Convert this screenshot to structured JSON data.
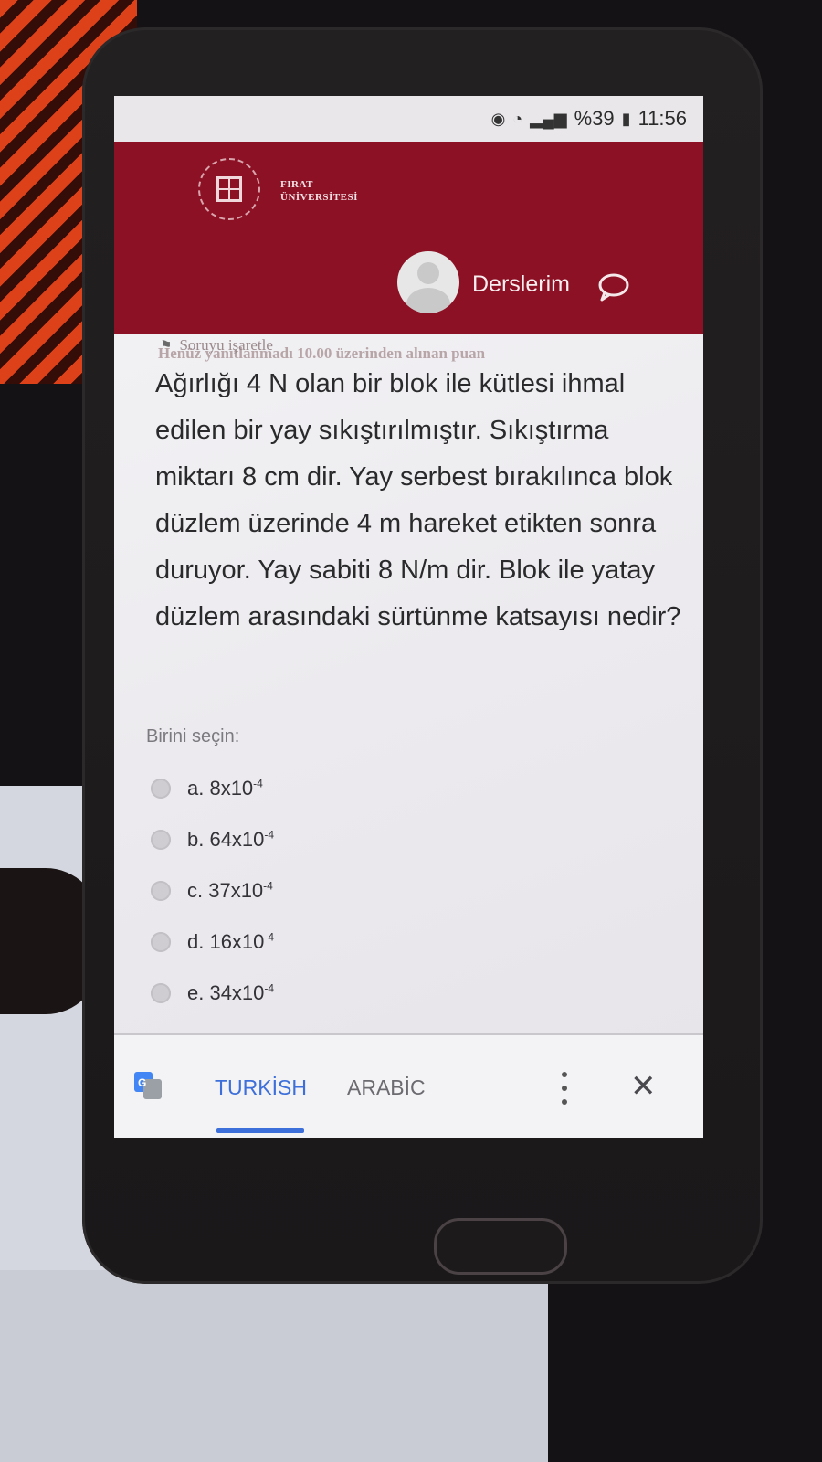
{
  "status_bar": {
    "battery": "%39",
    "time": "11:56"
  },
  "header": {
    "university_line1": "FIRAT",
    "university_line2": "ÜNİVERSİTESİ",
    "menu_courses": "Derslerim"
  },
  "question": {
    "grade_info": "Henüz yanıtlanmadı 10.00 üzerinden alınan puan",
    "flag_label": "Soruyu işaretle",
    "text": "Ağırlığı 4 N olan bir blok ile kütlesi ihmal edilen bir yay sıkıştırılmıştır. Sıkıştırma miktarı 8 cm dir. Yay serbest bırakılınca blok düzlem üzerinde 4 m hareket etikten sonra duruyor. Yay sabiti 8 N/m dir. Blok ile yatay düzlem arasındaki sürtünme katsayısı nedir?",
    "choose_label": "Birini seçin:",
    "options": [
      {
        "prefix": "a. 8x10",
        "exp": "-4"
      },
      {
        "prefix": "b. 64x10",
        "exp": "-4"
      },
      {
        "prefix": "c. 37x10",
        "exp": "-4"
      },
      {
        "prefix": "d. 16x10",
        "exp": "-4"
      },
      {
        "prefix": "e. 34x10",
        "exp": "-4"
      }
    ]
  },
  "translate_bar": {
    "tab_turkish": "TURKİSH",
    "tab_arabic": "ARABİC"
  },
  "colors": {
    "header_bg": "#8c1125",
    "active_tab": "#3c6fd9"
  }
}
